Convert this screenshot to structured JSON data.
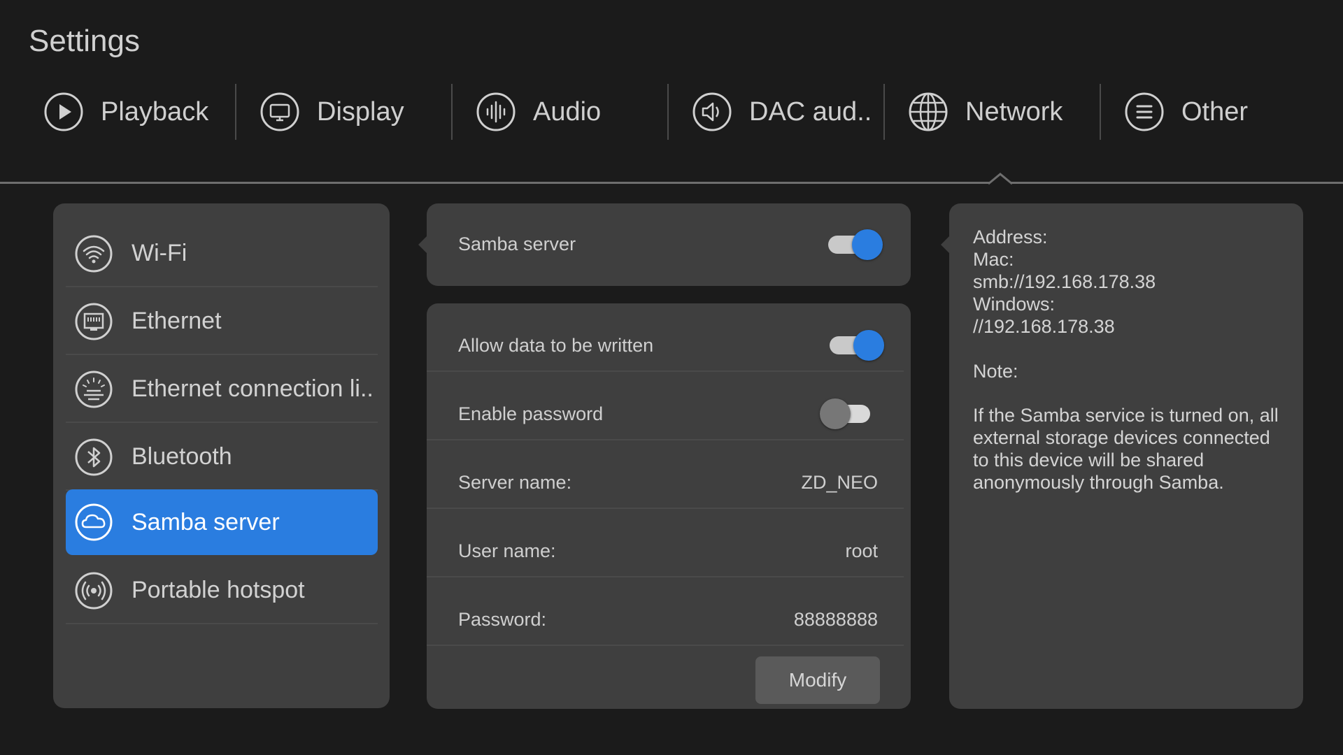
{
  "header": {
    "title": "Settings"
  },
  "tabs": [
    {
      "label": "Playback",
      "icon": "play-icon"
    },
    {
      "label": "Display",
      "icon": "monitor-icon"
    },
    {
      "label": "Audio",
      "icon": "audio-wave-icon"
    },
    {
      "label": "DAC aud..",
      "icon": "speaker-icon"
    },
    {
      "label": "Network",
      "icon": "globe-icon",
      "selected": true
    },
    {
      "label": "Other",
      "icon": "menu-list-icon"
    }
  ],
  "sidebar": {
    "items": [
      {
        "label": "Wi-Fi",
        "icon": "wifi-icon"
      },
      {
        "label": "Ethernet",
        "icon": "ethernet-icon"
      },
      {
        "label": "Ethernet connection li..",
        "icon": "ethernet-light-icon"
      },
      {
        "label": "Bluetooth",
        "icon": "bluetooth-icon"
      },
      {
        "label": "Samba server",
        "icon": "samba-cloud-icon",
        "active": true
      },
      {
        "label": "Portable hotspot",
        "icon": "hotspot-icon"
      }
    ]
  },
  "samba": {
    "label": "Samba server",
    "enabled": true
  },
  "settings": {
    "allow_write": {
      "label": "Allow data to be written",
      "enabled": true
    },
    "enable_password": {
      "label": "Enable password",
      "enabled": false
    },
    "server_name": {
      "label": "Server name:",
      "value": "ZD_NEO"
    },
    "user_name": {
      "label": "User name:",
      "value": "root"
    },
    "password": {
      "label": "Password:",
      "value": "88888888"
    },
    "modify_label": "Modify"
  },
  "info": {
    "address_label": "Address:",
    "mac_label": "Mac:",
    "mac_value": "smb://192.168.178.38",
    "windows_label": "Windows:",
    "windows_value": "//192.168.178.38",
    "note_label": "Note:",
    "note_text": "If the Samba service is turned on, all external storage devices connected to this device will be shared anonymously through Samba."
  },
  "colors": {
    "accent": "#2a7de0",
    "background": "#1b1b1b",
    "panel": "#3f3f3f"
  }
}
